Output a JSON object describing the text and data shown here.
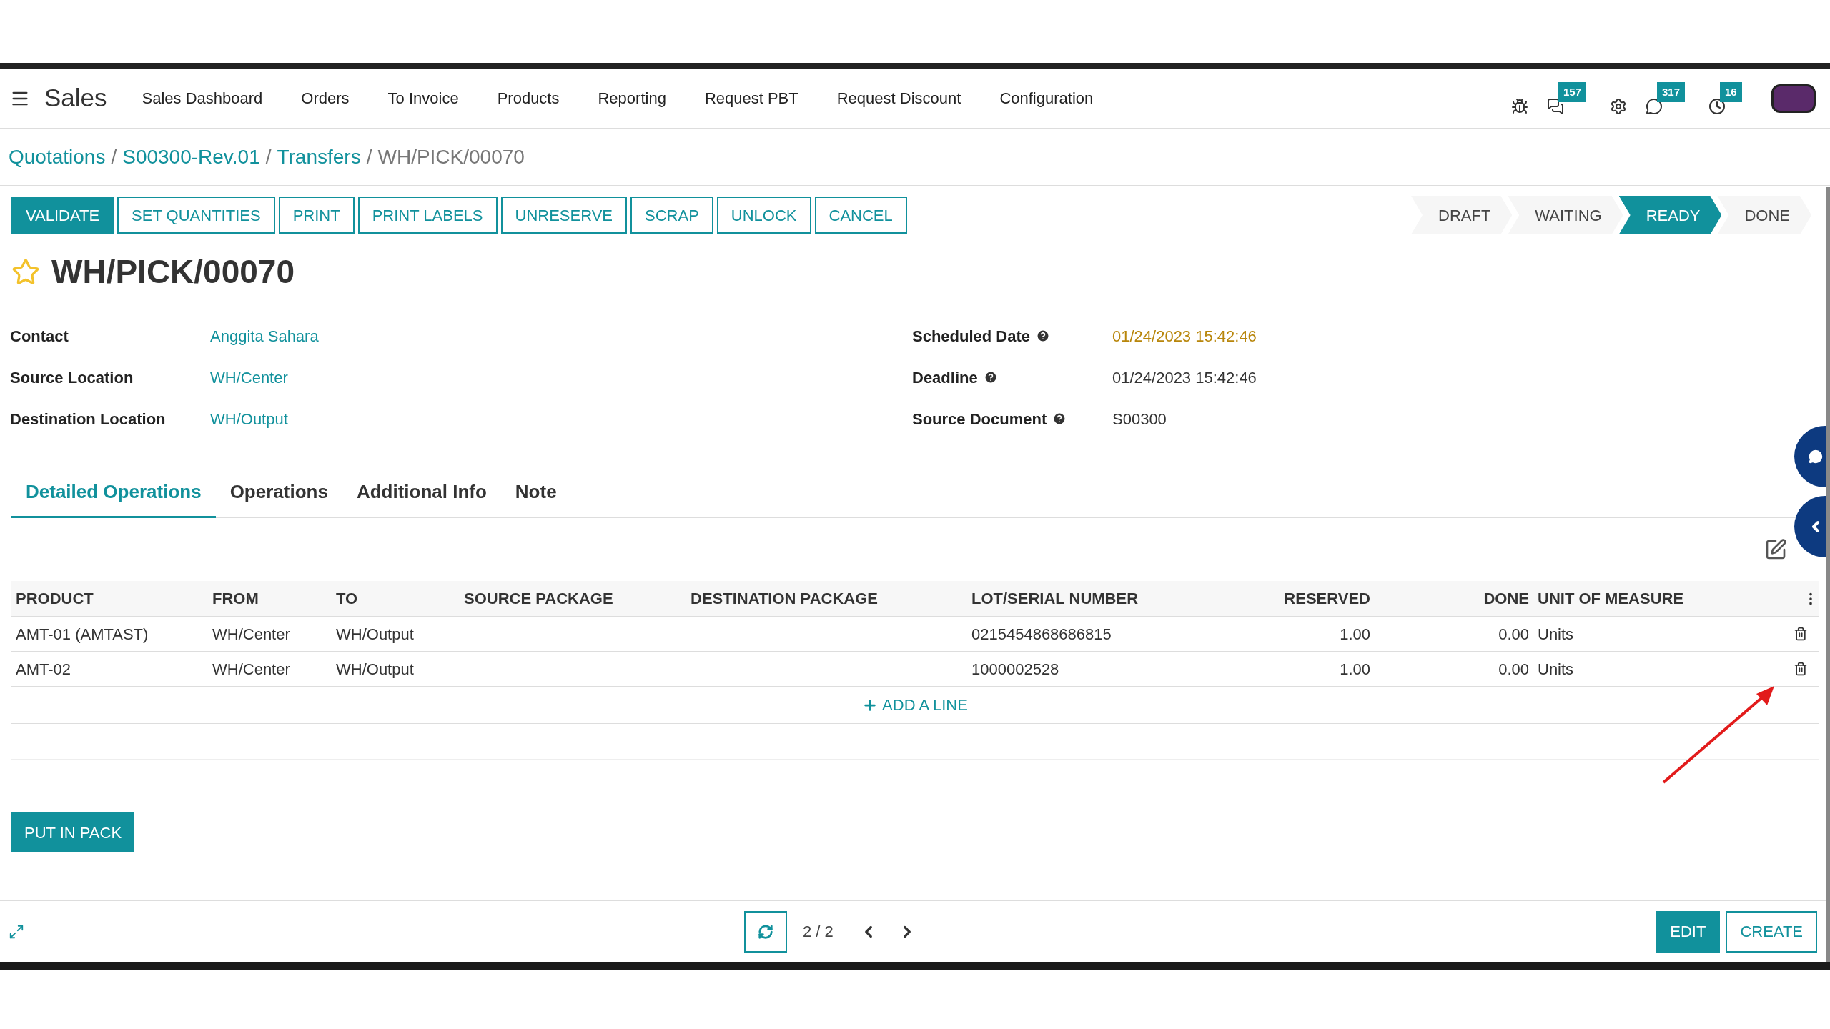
{
  "app": {
    "name": "Sales",
    "menu": [
      "Sales Dashboard",
      "Orders",
      "To Invoice",
      "Products",
      "Reporting",
      "Request PBT",
      "Request Discount",
      "Configuration"
    ]
  },
  "systray": [
    {
      "kind": "bug"
    },
    {
      "kind": "messages",
      "badge": "157"
    },
    {
      "kind": "settings"
    },
    {
      "kind": "whatsapp",
      "badge": "317"
    },
    {
      "kind": "activity",
      "badge": "16"
    }
  ],
  "breadcrumb": [
    {
      "label": "Quotations",
      "link": true
    },
    {
      "separator": "/",
      "label": "S00300-Rev.01",
      "link": true
    },
    {
      "separator": "/",
      "label": "Transfers",
      "link": true
    },
    {
      "separator": "/",
      "label": "WH/PICK/00070",
      "link": false
    }
  ],
  "actions": [
    {
      "label": "VALIDATE",
      "primary": true
    },
    {
      "label": "SET QUANTITIES",
      "primary": false
    },
    {
      "label": "PRINT",
      "primary": false
    },
    {
      "label": "PRINT LABELS",
      "primary": false
    },
    {
      "label": "UNRESERVE",
      "primary": false
    },
    {
      "label": "SCRAP",
      "primary": false
    },
    {
      "label": "UNLOCK",
      "primary": false
    },
    {
      "label": "CANCEL",
      "primary": false
    }
  ],
  "status": [
    {
      "label": "DRAFT",
      "selected": false
    },
    {
      "label": "WAITING",
      "selected": false
    },
    {
      "label": "READY",
      "selected": true
    },
    {
      "label": "DONE",
      "selected": false
    }
  ],
  "record": {
    "title": "WH/PICK/00070",
    "starred": false
  },
  "fields_left": [
    {
      "label": "Contact",
      "value": "Anggita Sahara",
      "kind": "link",
      "help": false
    },
    {
      "label": "Source Location",
      "value": "WH/Center",
      "kind": "link",
      "help": false
    },
    {
      "label": "Destination Location",
      "value": "WH/Output",
      "kind": "link",
      "help": false
    }
  ],
  "fields_right": [
    {
      "label": "Scheduled Date",
      "value": "01/24/2023 15:42:46",
      "kind": "warning",
      "help": true
    },
    {
      "label": "Deadline",
      "value": "01/24/2023 15:42:46",
      "kind": "text",
      "help": true
    },
    {
      "label": "Source Document",
      "value": "S00300",
      "kind": "text",
      "help": true
    }
  ],
  "tabs": [
    {
      "label": "Detailed Operations",
      "selected": true
    },
    {
      "label": "Operations",
      "selected": false
    },
    {
      "label": "Additional Info",
      "selected": false
    },
    {
      "label": "Note",
      "selected": false
    }
  ],
  "table": {
    "columns": [
      "PRODUCT",
      "FROM",
      "TO",
      "SOURCE PACKAGE",
      "DESTINATION PACKAGE",
      "LOT/SERIAL NUMBER",
      "RESERVED",
      "DONE",
      "UNIT OF MEASURE"
    ],
    "rows": [
      [
        "AMT-01 (AMTAST)",
        "WH/Center",
        "WH/Output",
        "",
        "",
        "0215454868686815",
        "1.00",
        "0.00",
        "Units"
      ],
      [
        "AMT-02",
        "WH/Center",
        "WH/Output",
        "",
        "",
        "1000002528",
        "1.00",
        "0.00",
        "Units"
      ]
    ],
    "add_line": "ADD A LINE"
  },
  "put_in_pack": "PUT IN PACK",
  "pager": "2 / 2",
  "footer_buttons": [
    {
      "label": "EDIT",
      "primary": true
    },
    {
      "label": "CREATE",
      "primary": false
    }
  ]
}
